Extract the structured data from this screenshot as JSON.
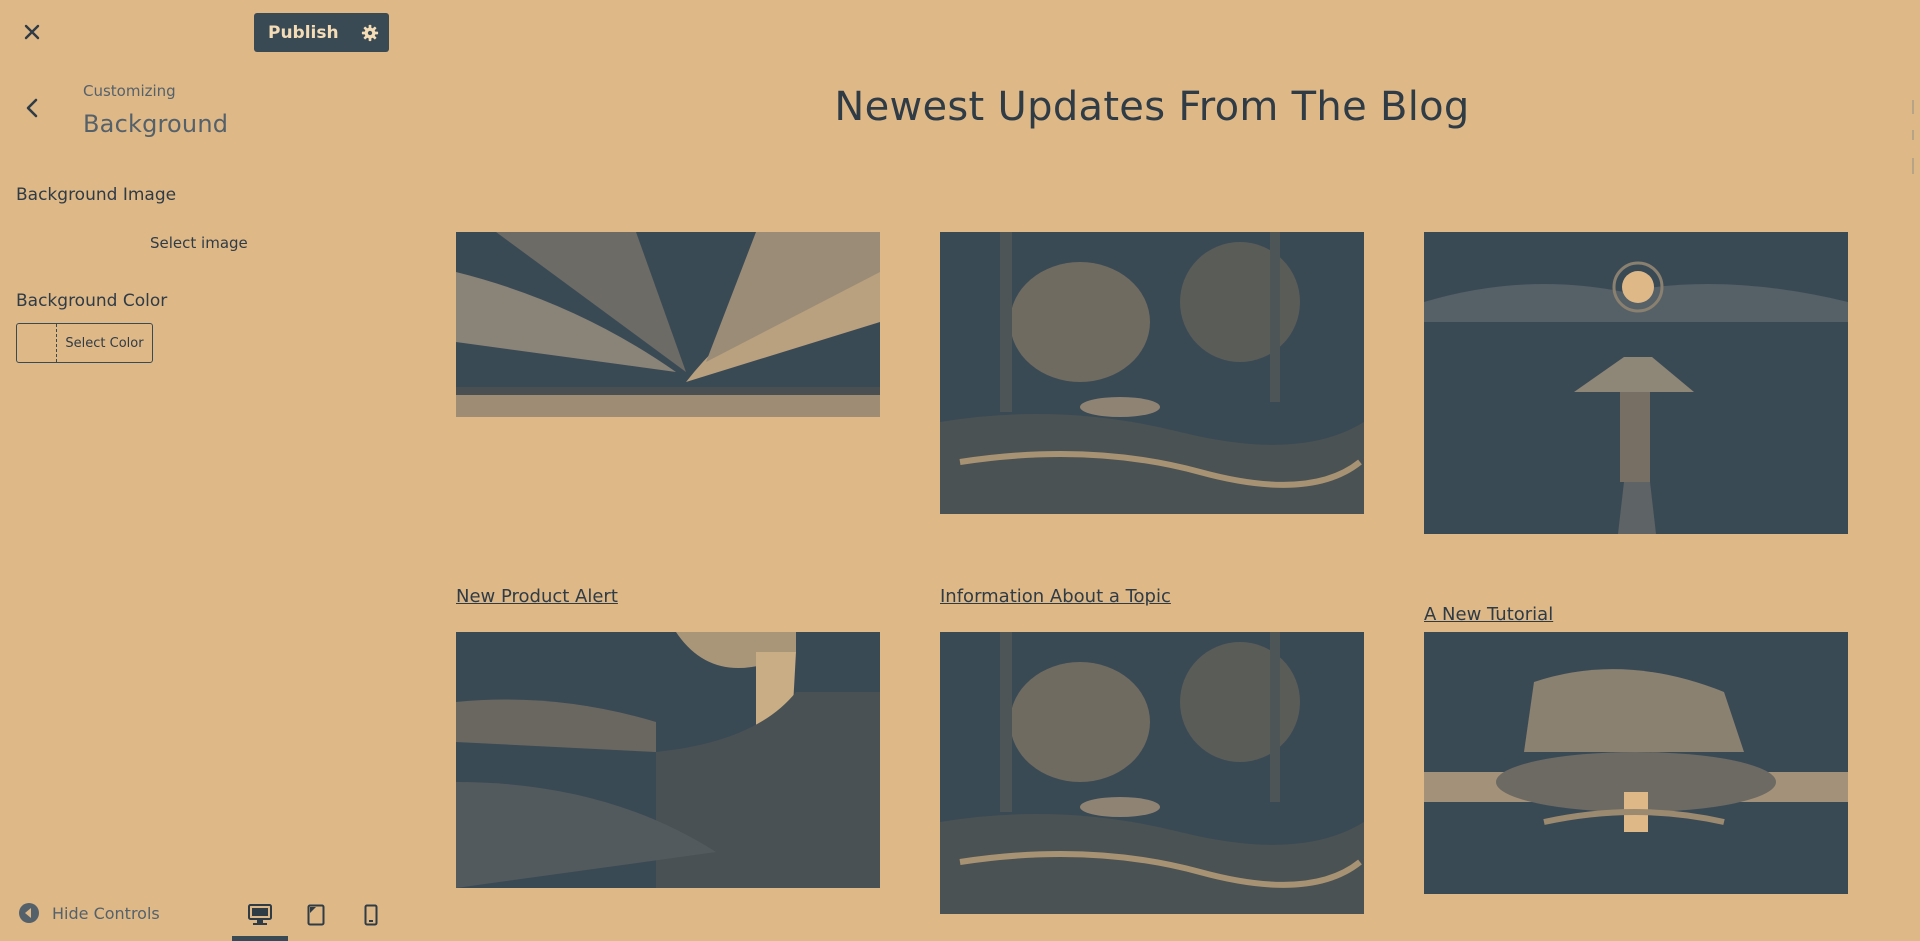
{
  "header": {
    "close_icon": "close-icon",
    "publish_label": "Publish",
    "publish_settings_icon": "gear-icon"
  },
  "panel": {
    "breadcrumb": "Customizing",
    "title": "Background",
    "background_image": {
      "label": "Background Image",
      "button": "Select image"
    },
    "background_color": {
      "label": "Background Color",
      "button": "Select Color"
    }
  },
  "footer": {
    "hide_controls": "Hide Controls",
    "devices": [
      "desktop",
      "tablet",
      "mobile"
    ],
    "active_device": "desktop"
  },
  "preview": {
    "heading": "Newest Updates From The Blog",
    "posts": [
      {
        "title": "",
        "image": "sky-over-sea"
      },
      {
        "title": "",
        "image": "forest-stream"
      },
      {
        "title": "",
        "image": "moonlit-pier"
      },
      {
        "title": "New Product Alert",
        "image": "waterfall-cliff"
      },
      {
        "title": "Information About a Topic",
        "image": "forest-stream"
      },
      {
        "title": "A New Tutorial",
        "image": "cave-tree"
      }
    ]
  },
  "colors": {
    "background": "#deb887",
    "ink": "#3a4a55",
    "text": "#2f3b45"
  }
}
